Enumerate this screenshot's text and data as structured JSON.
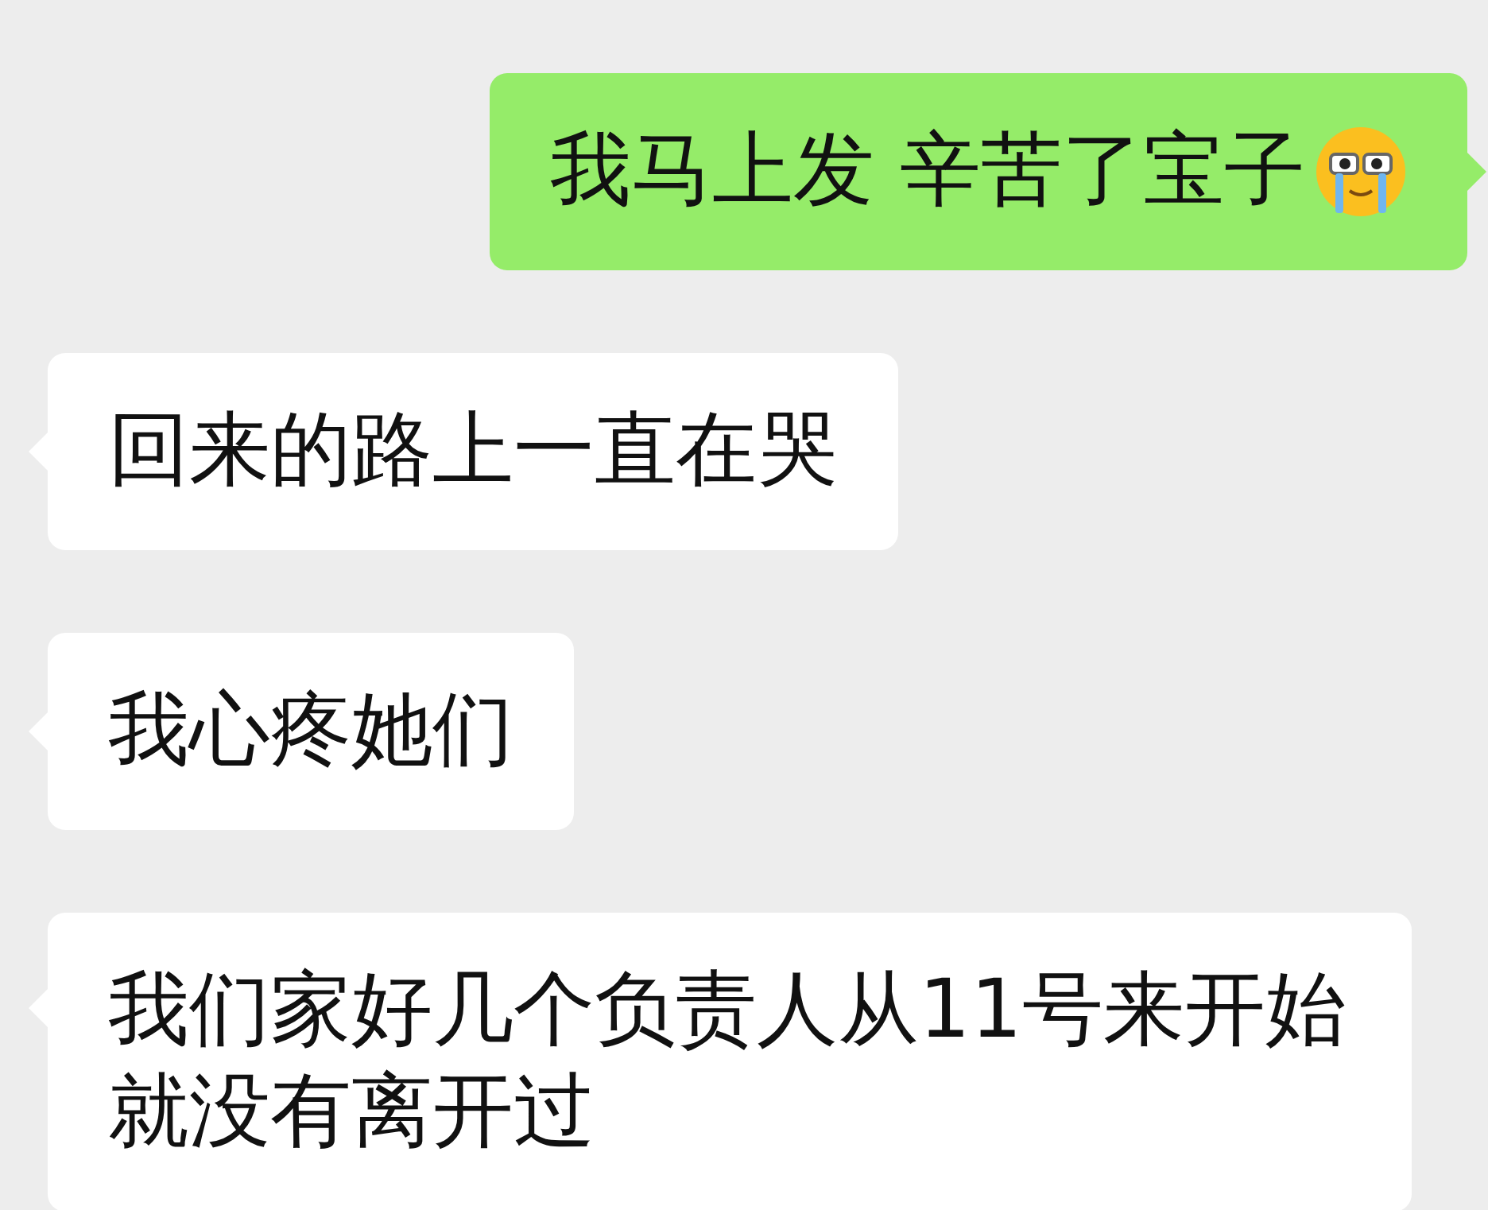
{
  "messages": [
    {
      "outgoing": true,
      "text": "我马上发 辛苦了宝子",
      "has_emoji": true
    },
    {
      "outgoing": false,
      "text": "回来的路上一直在哭",
      "has_emoji": false
    },
    {
      "outgoing": false,
      "text": "我心疼她们",
      "has_emoji": false
    },
    {
      "outgoing": false,
      "text": "我们家好几个负责人从11号来开始就没有离开过",
      "has_emoji": false
    }
  ]
}
